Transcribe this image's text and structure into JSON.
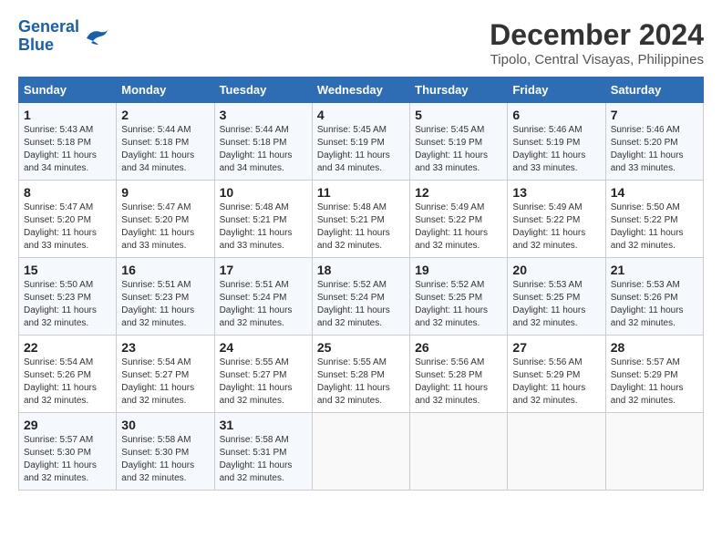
{
  "header": {
    "logo_line1": "General",
    "logo_line2": "Blue",
    "title": "December 2024",
    "subtitle": "Tipolo, Central Visayas, Philippines"
  },
  "calendar": {
    "days_of_week": [
      "Sunday",
      "Monday",
      "Tuesday",
      "Wednesday",
      "Thursday",
      "Friday",
      "Saturday"
    ],
    "weeks": [
      [
        {
          "day": "",
          "info": ""
        },
        {
          "day": "2",
          "info": "Sunrise: 5:44 AM\nSunset: 5:18 PM\nDaylight: 11 hours\nand 34 minutes."
        },
        {
          "day": "3",
          "info": "Sunrise: 5:44 AM\nSunset: 5:18 PM\nDaylight: 11 hours\nand 34 minutes."
        },
        {
          "day": "4",
          "info": "Sunrise: 5:45 AM\nSunset: 5:19 PM\nDaylight: 11 hours\nand 34 minutes."
        },
        {
          "day": "5",
          "info": "Sunrise: 5:45 AM\nSunset: 5:19 PM\nDaylight: 11 hours\nand 33 minutes."
        },
        {
          "day": "6",
          "info": "Sunrise: 5:46 AM\nSunset: 5:19 PM\nDaylight: 11 hours\nand 33 minutes."
        },
        {
          "day": "7",
          "info": "Sunrise: 5:46 AM\nSunset: 5:20 PM\nDaylight: 11 hours\nand 33 minutes."
        }
      ],
      [
        {
          "day": "1",
          "info": "Sunrise: 5:43 AM\nSunset: 5:18 PM\nDaylight: 11 hours\nand 34 minutes."
        },
        {
          "day": "",
          "info": ""
        },
        {
          "day": "",
          "info": ""
        },
        {
          "day": "",
          "info": ""
        },
        {
          "day": "",
          "info": ""
        },
        {
          "day": "",
          "info": ""
        },
        {
          "day": "",
          "info": ""
        }
      ],
      [
        {
          "day": "8",
          "info": "Sunrise: 5:47 AM\nSunset: 5:20 PM\nDaylight: 11 hours\nand 33 minutes."
        },
        {
          "day": "9",
          "info": "Sunrise: 5:47 AM\nSunset: 5:20 PM\nDaylight: 11 hours\nand 33 minutes."
        },
        {
          "day": "10",
          "info": "Sunrise: 5:48 AM\nSunset: 5:21 PM\nDaylight: 11 hours\nand 33 minutes."
        },
        {
          "day": "11",
          "info": "Sunrise: 5:48 AM\nSunset: 5:21 PM\nDaylight: 11 hours\nand 32 minutes."
        },
        {
          "day": "12",
          "info": "Sunrise: 5:49 AM\nSunset: 5:22 PM\nDaylight: 11 hours\nand 32 minutes."
        },
        {
          "day": "13",
          "info": "Sunrise: 5:49 AM\nSunset: 5:22 PM\nDaylight: 11 hours\nand 32 minutes."
        },
        {
          "day": "14",
          "info": "Sunrise: 5:50 AM\nSunset: 5:22 PM\nDaylight: 11 hours\nand 32 minutes."
        }
      ],
      [
        {
          "day": "15",
          "info": "Sunrise: 5:50 AM\nSunset: 5:23 PM\nDaylight: 11 hours\nand 32 minutes."
        },
        {
          "day": "16",
          "info": "Sunrise: 5:51 AM\nSunset: 5:23 PM\nDaylight: 11 hours\nand 32 minutes."
        },
        {
          "day": "17",
          "info": "Sunrise: 5:51 AM\nSunset: 5:24 PM\nDaylight: 11 hours\nand 32 minutes."
        },
        {
          "day": "18",
          "info": "Sunrise: 5:52 AM\nSunset: 5:24 PM\nDaylight: 11 hours\nand 32 minutes."
        },
        {
          "day": "19",
          "info": "Sunrise: 5:52 AM\nSunset: 5:25 PM\nDaylight: 11 hours\nand 32 minutes."
        },
        {
          "day": "20",
          "info": "Sunrise: 5:53 AM\nSunset: 5:25 PM\nDaylight: 11 hours\nand 32 minutes."
        },
        {
          "day": "21",
          "info": "Sunrise: 5:53 AM\nSunset: 5:26 PM\nDaylight: 11 hours\nand 32 minutes."
        }
      ],
      [
        {
          "day": "22",
          "info": "Sunrise: 5:54 AM\nSunset: 5:26 PM\nDaylight: 11 hours\nand 32 minutes."
        },
        {
          "day": "23",
          "info": "Sunrise: 5:54 AM\nSunset: 5:27 PM\nDaylight: 11 hours\nand 32 minutes."
        },
        {
          "day": "24",
          "info": "Sunrise: 5:55 AM\nSunset: 5:27 PM\nDaylight: 11 hours\nand 32 minutes."
        },
        {
          "day": "25",
          "info": "Sunrise: 5:55 AM\nSunset: 5:28 PM\nDaylight: 11 hours\nand 32 minutes."
        },
        {
          "day": "26",
          "info": "Sunrise: 5:56 AM\nSunset: 5:28 PM\nDaylight: 11 hours\nand 32 minutes."
        },
        {
          "day": "27",
          "info": "Sunrise: 5:56 AM\nSunset: 5:29 PM\nDaylight: 11 hours\nand 32 minutes."
        },
        {
          "day": "28",
          "info": "Sunrise: 5:57 AM\nSunset: 5:29 PM\nDaylight: 11 hours\nand 32 minutes."
        }
      ],
      [
        {
          "day": "29",
          "info": "Sunrise: 5:57 AM\nSunset: 5:30 PM\nDaylight: 11 hours\nand 32 minutes."
        },
        {
          "day": "30",
          "info": "Sunrise: 5:58 AM\nSunset: 5:30 PM\nDaylight: 11 hours\nand 32 minutes."
        },
        {
          "day": "31",
          "info": "Sunrise: 5:58 AM\nSunset: 5:31 PM\nDaylight: 11 hours\nand 32 minutes."
        },
        {
          "day": "",
          "info": ""
        },
        {
          "day": "",
          "info": ""
        },
        {
          "day": "",
          "info": ""
        },
        {
          "day": "",
          "info": ""
        }
      ]
    ]
  }
}
